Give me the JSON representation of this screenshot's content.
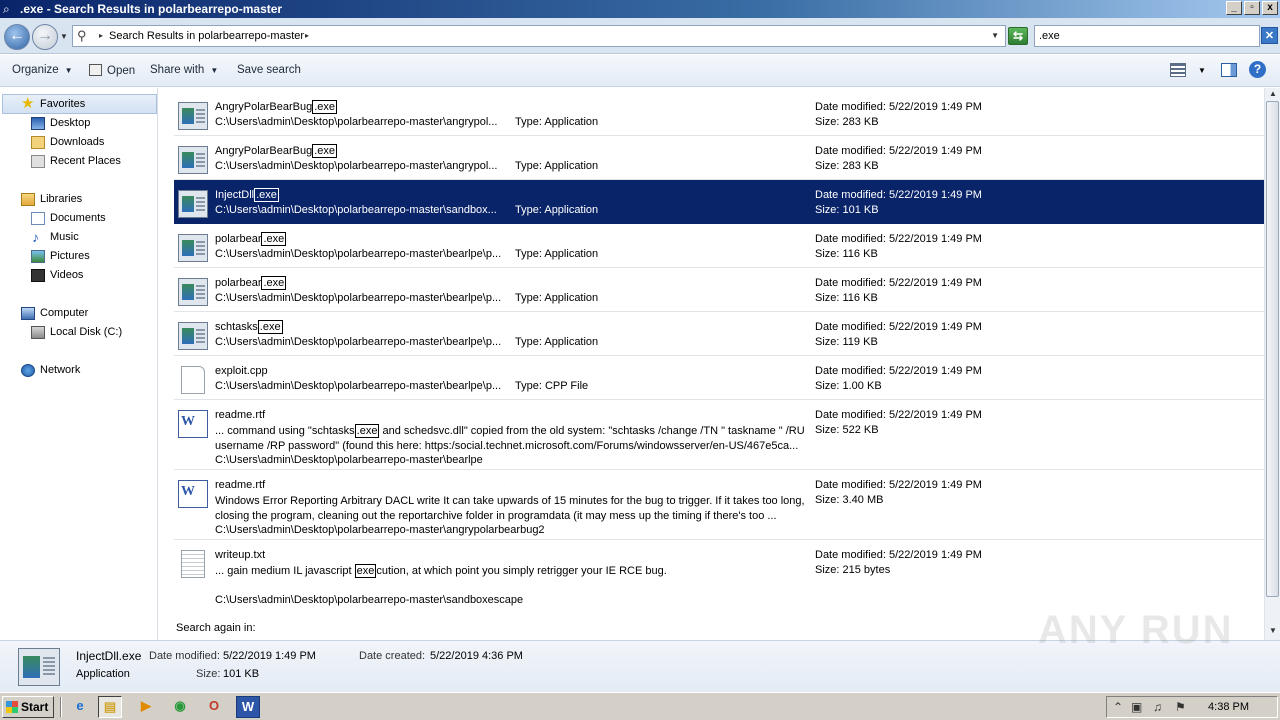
{
  "window": {
    "title": ".exe - Search Results in polarbearrepo-master",
    "min": "_",
    "max": "▫",
    "close": "x"
  },
  "address": {
    "path": "Search Results in polarbearrepo-master",
    "search_value": ".exe"
  },
  "toolbar": {
    "organize": "Organize",
    "open": "Open",
    "share_with": "Share with",
    "save_search": "Save search"
  },
  "sidebar": {
    "favorites": "Favorites",
    "desktop": "Desktop",
    "downloads": "Downloads",
    "recent": "Recent Places",
    "libraries": "Libraries",
    "documents": "Documents",
    "music": "Music",
    "pictures": "Pictures",
    "videos": "Videos",
    "computer": "Computer",
    "local_disk": "Local Disk (C:)",
    "network": "Network"
  },
  "results": [
    {
      "name_pre": "AngryPolarBearBug",
      "name_hl": ".exe",
      "path": "C:\\Users\\admin\\Desktop\\polarbearrepo-master\\angrypol...",
      "type": "Type: Application",
      "date": "Date modified: 5/22/2019 1:49 PM",
      "size": "Size: 283 KB"
    },
    {
      "name_pre": "AngryPolarBearBug",
      "name_hl": ".exe",
      "path": "C:\\Users\\admin\\Desktop\\polarbearrepo-master\\angrypol...",
      "type": "Type: Application",
      "date": "Date modified: 5/22/2019 1:49 PM",
      "size": "Size: 283 KB"
    },
    {
      "name_pre": "InjectDll",
      "name_hl": ".exe",
      "path": "C:\\Users\\admin\\Desktop\\polarbearrepo-master\\sandbox...",
      "type": "Type: Application",
      "date": "Date modified: 5/22/2019 1:49 PM",
      "size": "Size: 101 KB"
    },
    {
      "name_pre": "polarbear",
      "name_hl": ".exe",
      "path": "C:\\Users\\admin\\Desktop\\polarbearrepo-master\\bearlpe\\p...",
      "type": "Type: Application",
      "date": "Date modified: 5/22/2019 1:49 PM",
      "size": "Size: 116 KB"
    },
    {
      "name_pre": "polarbear",
      "name_hl": ".exe",
      "path": "C:\\Users\\admin\\Desktop\\polarbearrepo-master\\bearlpe\\p...",
      "type": "Type: Application",
      "date": "Date modified: 5/22/2019 1:49 PM",
      "size": "Size: 116 KB"
    },
    {
      "name_pre": "schtasks",
      "name_hl": ".exe",
      "path": "C:\\Users\\admin\\Desktop\\polarbearrepo-master\\bearlpe\\p...",
      "type": "Type: Application",
      "date": "Date modified: 5/22/2019 1:49 PM",
      "size": "Size: 119 KB"
    },
    {
      "name": "exploit.cpp",
      "path": "C:\\Users\\admin\\Desktop\\polarbearrepo-master\\bearlpe\\p...",
      "type": "Type: CPP File",
      "date": "Date modified: 5/22/2019 1:49 PM",
      "size": "Size: 1.00 KB"
    },
    {
      "name": "readme.rtf",
      "snip_pre": "... command using \"schtasks",
      "snip_hl": ".exe",
      "snip_post": " and schedsvc.dll\" copied from the old system: \"schtasks /change /TN \" taskname \" /RU username /RP password\" (found this here: https:/social.technet.microsoft.com/Forums/windowsserver/en-US/467e5ca...",
      "path": "C:\\Users\\admin\\Desktop\\polarbearrepo-master\\bearlpe",
      "date": "Date modified: 5/22/2019 1:49 PM",
      "size": "Size: 522 KB"
    },
    {
      "name": "readme.rtf",
      "snip": "Windows Error Reporting Arbitrary DACL write It can take upwards of 15 minutes for the bug to trigger. If it takes too long, closing the program, cleaning out the reportarchive folder in programdata (it may mess up the timing if there's too ...",
      "path": "C:\\Users\\admin\\Desktop\\polarbearrepo-master\\angrypolarbearbug2",
      "date": "Date modified: 5/22/2019 1:49 PM",
      "size": "Size: 3.40 MB"
    },
    {
      "name": "writeup.txt",
      "snip_pre": "... gain medium IL javascript ",
      "snip_hl": "exe",
      "snip_post": "cution, at which point you simply retrigger your IE RCE bug.",
      "path": "C:\\Users\\admin\\Desktop\\polarbearrepo-master\\sandboxescape",
      "date": "Date modified: 5/22/2019 1:49 PM",
      "size": "Size: 215 bytes"
    }
  ],
  "search_again": "Search again in:",
  "details": {
    "name": "InjectDll.exe",
    "date_modified_label": "Date modified:",
    "date_modified": "5/22/2019 1:49 PM",
    "date_created_label": "Date created:",
    "date_created": "5/22/2019 4:36 PM",
    "type": "Application",
    "size_label": "Size:",
    "size": "101 KB"
  },
  "taskbar": {
    "start": "Start",
    "clock": "4:38 PM"
  },
  "watermark": "ANY RUN"
}
